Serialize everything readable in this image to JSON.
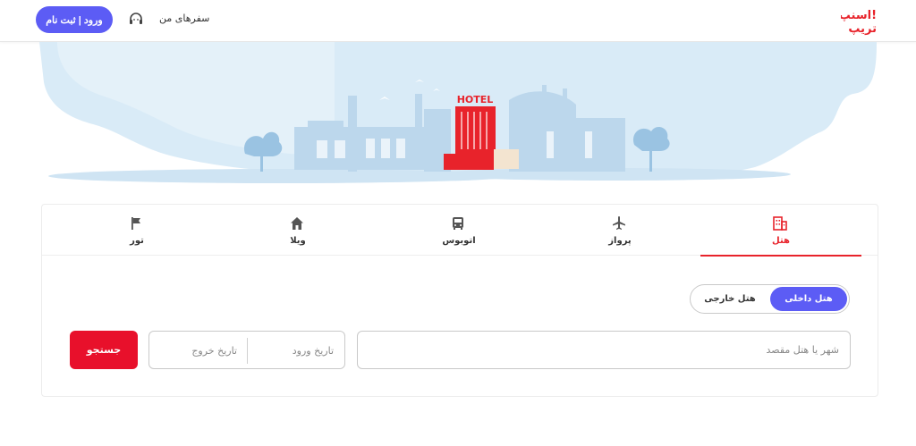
{
  "header": {
    "login_label": "ورود | ثبت نام",
    "my_trips_label": "سفرهای من",
    "logo_text_line1": "اسنپ!",
    "logo_text_line2": "تریپ"
  },
  "hero": {
    "sign_text": "HOTEL"
  },
  "tabs": [
    {
      "label": "هتل",
      "icon": "hotel-icon",
      "active": true
    },
    {
      "label": "پرواز",
      "icon": "airplane-icon",
      "active": false
    },
    {
      "label": "اتوبوس",
      "icon": "bus-icon",
      "active": false
    },
    {
      "label": "ویلا",
      "icon": "home-icon",
      "active": false
    },
    {
      "label": "تور",
      "icon": "flag-icon",
      "active": false
    }
  ],
  "hotel_type": {
    "options": [
      "هتل داخلی",
      "هتل خارجی"
    ],
    "selected": "هتل داخلی"
  },
  "search": {
    "destination_placeholder": "شهر یا هتل مقصد",
    "checkin_label": "تاریخ ورود",
    "checkout_label": "تاریخ خروج",
    "button_label": "جستجو"
  },
  "colors": {
    "primary": "#5c5cf5",
    "accent": "#e8232b",
    "search_button": "#e8102b"
  }
}
